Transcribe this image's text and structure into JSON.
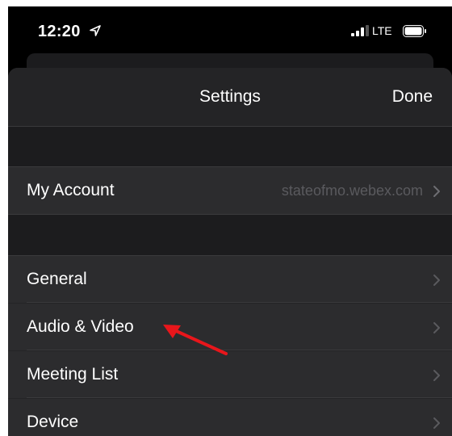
{
  "status_bar": {
    "time": "12:20",
    "network": "LTE",
    "icons": [
      "location-arrow-icon",
      "signal-bars-icon",
      "battery-icon"
    ]
  },
  "nav": {
    "title": "Settings",
    "done_label": "Done"
  },
  "account_section": {
    "label": "My Account",
    "detail": "stateofmo.webex.com"
  },
  "settings_items": [
    {
      "label": "General"
    },
    {
      "label": "Audio & Video"
    },
    {
      "label": "Meeting List"
    },
    {
      "label": "Device"
    }
  ],
  "colors": {
    "annotation_arrow": "#e8161b",
    "sheet_background": "#242426",
    "row_background": "#2c2c2e",
    "detail_text": "#5a5a5e"
  }
}
